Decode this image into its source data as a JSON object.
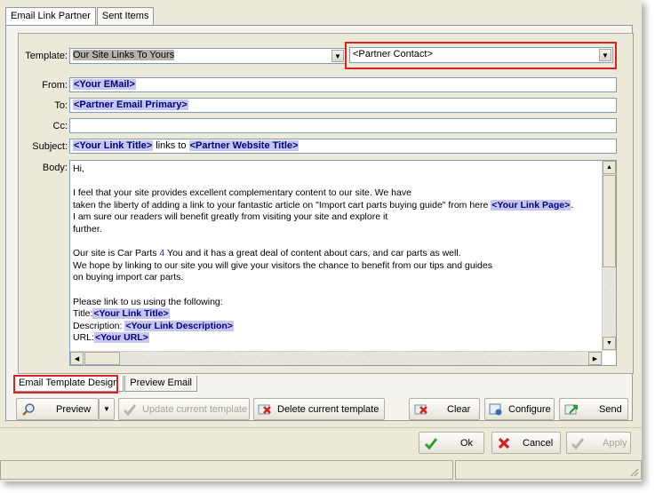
{
  "tabs": {
    "email_link_partner": "Email Link Partner",
    "sent_items": "Sent Items"
  },
  "labels": {
    "template": "Template:",
    "from": "From:",
    "to": "To:",
    "cc": "Cc:",
    "subject": "Subject:",
    "body": "Body:"
  },
  "template": {
    "selected": "Our Site Links To Yours",
    "contact_selected": "<Partner Contact>"
  },
  "from_token": "<Your EMail>",
  "to_token": "<Partner Email Primary>",
  "cc": "",
  "subject": {
    "tok1": "<Your Link Title>",
    "mid": " links to ",
    "tok2": "<Partner Website Title>"
  },
  "body": {
    "l1": "Hi,",
    "l2": "",
    "l3": "I feel that your site provides excellent complementary content to our site. We have",
    "l4a": "taken the liberty of adding a link to your fantastic article on \"Import cart parts buying guide\" from here ",
    "l4tok": "<Your Link Page>",
    "l4b": ".",
    "l5": "I am sure our readers will benefit greatly from visiting your site and explore it",
    "l6": "further.",
    "l7": "",
    "l8a": "Our site is Car Parts ",
    "l8num": "4",
    "l8b": " You and it has a great deal of content about cars, and car parts as well.",
    "l9": "We hope by linking to our site you will give your visitors the chance to benefit from our tips and guides",
    "l10": "on buying import car parts.",
    "l11": "",
    "l12": "Please link to us using the following:",
    "l13a": "Title:",
    "l13tok": "<Your Link Title>",
    "l14a": "Description: ",
    "l14tok": "<Your Link Description>",
    "l15a": "URL:",
    "l15tok": "<Your URL>"
  },
  "design_tabs": {
    "design": "Email Template Design",
    "preview": "Preview Email"
  },
  "toolbar": {
    "preview": "Preview",
    "update": "Update current template",
    "delete": "Delete current template",
    "clear": "Clear",
    "configure": "Configure",
    "send": "Send"
  },
  "dialog": {
    "ok": "Ok",
    "cancel": "Cancel",
    "apply": "Apply"
  },
  "colors": {
    "highlight": "#e02020",
    "token_bg": "#c6c6f3",
    "token_text": "#000080"
  }
}
